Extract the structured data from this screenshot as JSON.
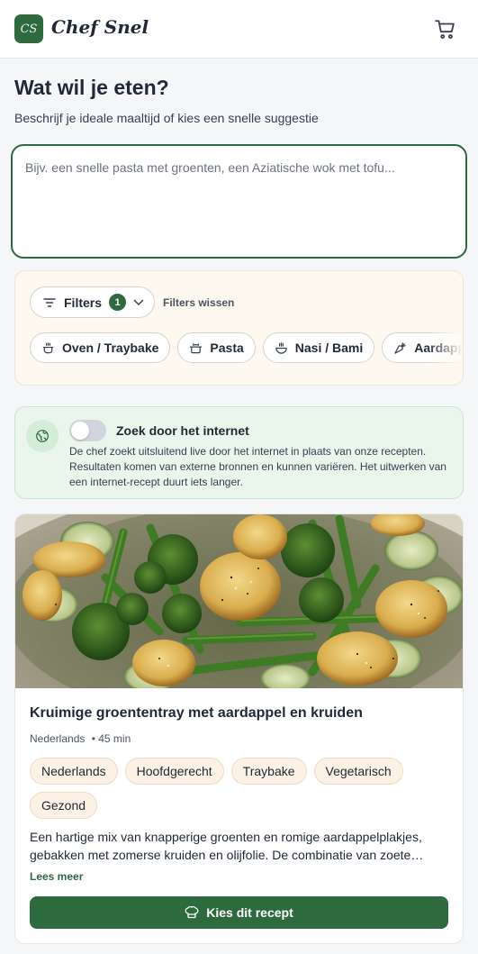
{
  "header": {
    "logo_text": "CS",
    "brand": "Chef Snel",
    "cart_icon": "cart-icon"
  },
  "main": {
    "title": "Wat wil je eten?",
    "subtitle": "Beschrijf je ideale maaltijd of kies een snelle suggestie",
    "prompt_placeholder": "Bijv. een snelle pasta met groenten, een Aziatische wok met tofu..."
  },
  "filters": {
    "button_label": "Filters",
    "active_count": "1",
    "clear_label": "Filters wissen",
    "suggestions": [
      {
        "label": "Oven / Traybake",
        "icon": "pot-icon"
      },
      {
        "label": "Pasta",
        "icon": "pot-icon"
      },
      {
        "label": "Nasi / Bami",
        "icon": "bowl-icon"
      },
      {
        "label": "Aardappel",
        "icon": "carrot-icon"
      }
    ]
  },
  "web_search": {
    "title": "Zoek door het internet",
    "enabled": false,
    "description": "De chef zoekt uitsluitend live door het internet in plaats van onze recepten. Resultaten komen van externe bronnen en kunnen variëren. Het uitwerken van een internet-recept duurt iets langer.",
    "icon": "globe-icon"
  },
  "recipe": {
    "title": "Kruimige groententray met aardappel en kruiden",
    "cuisine": "Nederlands",
    "time": "• 45 min",
    "tags": [
      "Nederlands",
      "Hoofdgerecht",
      "Traybake",
      "Vegetarisch",
      "Gezond"
    ],
    "description": "Een hartige mix van knapperige groenten en romige aardappelplakjes, gebakken met zomerse kruiden en olijfolie. De combinatie van zoete…",
    "read_more": "Lees meer",
    "choose_label": "Kies dit recept"
  },
  "colors": {
    "accent": "#2d6a3e",
    "panel": "#fdf9f1",
    "web_panel": "#eaf5ec",
    "tag_bg": "#fbf1e4"
  }
}
